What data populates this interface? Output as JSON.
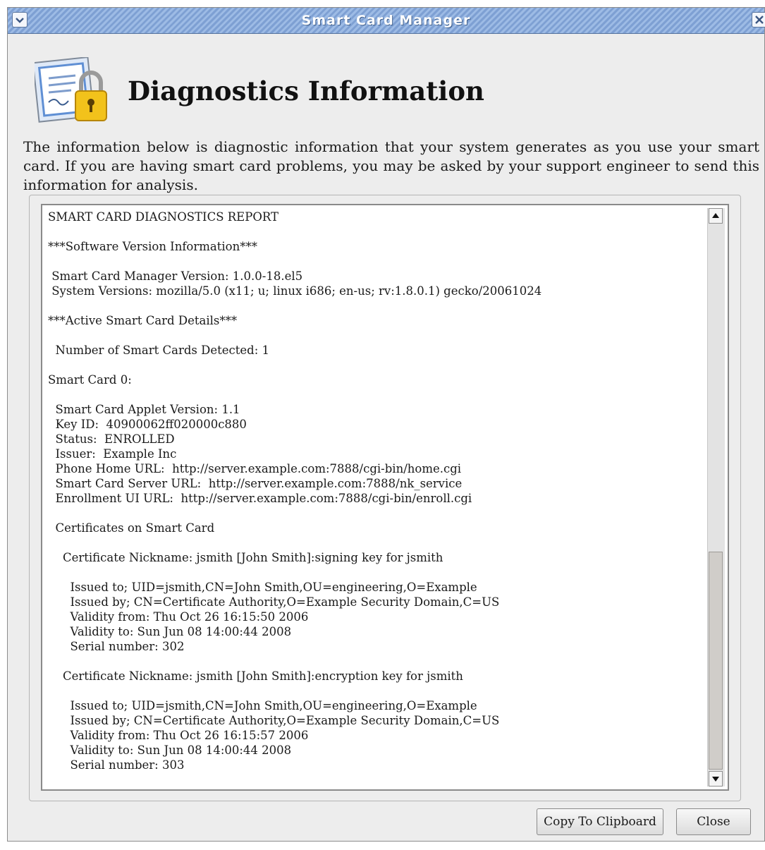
{
  "window": {
    "title": "Smart Card Manager"
  },
  "header": {
    "heading": "Diagnostics Information",
    "icon": "certificate-lock-icon"
  },
  "intro": "The information below is diagnostic information that your system generates as you use your smart card. If you are having smart card problems, you may be asked by your support engineer to send this information for analysis.",
  "report": {
    "lines": [
      "SMART CARD DIAGNOSTICS REPORT",
      "",
      "***Software Version Information***",
      "",
      " Smart Card Manager Version: 1.0.0-18.el5",
      " System Versions: mozilla/5.0 (x11; u; linux i686; en-us; rv:1.8.0.1) gecko/20061024",
      "",
      "***Active Smart Card Details***",
      "",
      "  Number of Smart Cards Detected: 1",
      "",
      "Smart Card 0:",
      "",
      "  Smart Card Applet Version: 1.1",
      "  Key ID:  40900062ff020000c880",
      "  Status:  ENROLLED",
      "  Issuer:  Example Inc",
      "  Phone Home URL:  http://server.example.com:7888/cgi-bin/home.cgi",
      "  Smart Card Server URL:  http://server.example.com:7888/nk_service",
      "  Enrollment UI URL:  http://server.example.com:7888/cgi-bin/enroll.cgi",
      "",
      "  Certificates on Smart Card",
      "",
      "    Certificate Nickname: jsmith [John Smith]:signing key for jsmith",
      "",
      "      Issued to; UID=jsmith,CN=John Smith,OU=engineering,O=Example",
      "      Issued by; CN=Certificate Authority,O=Example Security Domain,C=US",
      "      Validity from: Thu Oct 26 16:15:50 2006",
      "      Validity to: Sun Jun 08 14:00:44 2008",
      "      Serial number: 302",
      "",
      "    Certificate Nickname: jsmith [John Smith]:encryption key for jsmith",
      "",
      "      Issued to; UID=jsmith,CN=John Smith,OU=engineering,O=Example",
      "      Issued by; CN=Certificate Authority,O=Example Security Domain,C=US",
      "      Validity from: Thu Oct 26 16:15:57 2006",
      "      Validity to: Sun Jun 08 14:00:44 2008",
      "      Serial number: 303"
    ],
    "scroll_position_fraction": 0.6,
    "visible_fraction": 0.4
  },
  "buttons": {
    "copy": "Copy To Clipboard",
    "close": "Close"
  },
  "colors": {
    "titlebar": "#8fb0de",
    "window_bg": "#ededed"
  }
}
